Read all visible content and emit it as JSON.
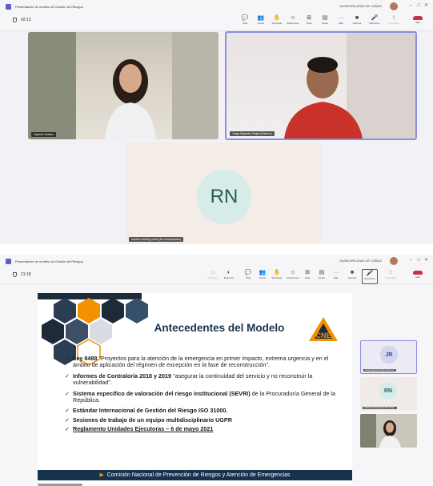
{
  "windows": [
    {
      "title": "Presentación de modelo de Gestión de Riesgos",
      "org": "MUNICIPALIDAD DE CAÑAS",
      "timer": "42:13",
      "toolbar": [
        {
          "icon": "chat-icon",
          "label": "Chat"
        },
        {
          "icon": "people-icon",
          "label": "Gente"
        },
        {
          "icon": "raise-hand-icon",
          "label": "Participar"
        },
        {
          "icon": "reaction-icon",
          "label": "Reaccionar"
        },
        {
          "icon": "view-icon",
          "label": "Vista"
        },
        {
          "icon": "notes-icon",
          "label": "Notas"
        },
        {
          "icon": "more-icon",
          "label": "Más"
        },
        {
          "icon": "camera-icon",
          "label": "Cámara"
        },
        {
          "icon": "mic-icon",
          "label": "Micrófono"
        },
        {
          "icon": "share-icon",
          "label": "Compartir"
        },
        {
          "icon": "leave-icon",
          "label": "Salir"
        }
      ],
      "participants": [
        {
          "name": "Oyalene Solano"
        },
        {
          "name": "Jorge Alejandro Rojas (Externo)"
        },
        {
          "name": "madrid meeting notes (No comprobado)",
          "initials": "RN"
        }
      ]
    },
    {
      "title": "Presentación de modelo de Gestión de Riesgos",
      "org": "MUNICIPALIDAD DE CAÑAS",
      "timer": "21:18",
      "toolbar": [
        {
          "icon": "whiteboard-icon",
          "label": "Controles"
        },
        {
          "icon": "reaction-icon-2",
          "label": "Reacción"
        },
        {
          "icon": "chat-icon",
          "label": "Chat"
        },
        {
          "icon": "people-icon",
          "label": "Gente"
        },
        {
          "icon": "raise-hand-icon",
          "label": "Participar"
        },
        {
          "icon": "reaction-icon",
          "label": "Reaccionar"
        },
        {
          "icon": "view-icon",
          "label": "Vista"
        },
        {
          "icon": "notes-icon",
          "label": "Notas"
        },
        {
          "icon": "more-icon",
          "label": "Más"
        },
        {
          "icon": "camera-icon",
          "label": "Cámara"
        },
        {
          "icon": "mic-icon",
          "label": "Micrófono"
        },
        {
          "icon": "share-icon",
          "label": "Compartir"
        },
        {
          "icon": "leave-icon",
          "label": "Salir"
        }
      ],
      "slide": {
        "title": "Antecedentes del Modelo",
        "logo_text": "CNE",
        "bullets": [
          {
            "bold": "Ley 8488",
            "text": " \"Proyectos para la atención de la emergencia en primer impacto, extrema urgencia y en el ámbito de aplicación del régimen de excepción en la fase de reconstrucción\"."
          },
          {
            "bold": "Informes de Contraloría 2018 y 2019",
            "text": " \"asegurar la continuidad del servicio y no reconstruir la vulnerabilidad\"."
          },
          {
            "bold": "Sistema específico de valoración del riesgo institucional (SEVRI)",
            "text": " de la Procuraduría General de la República."
          },
          {
            "bold": "Estándar Internacional de Gestión del Riesgo ISO 31000.",
            "text": ""
          },
          {
            "bold": "Sesiones de trabajo de un equipo multidisciplinario UGPR",
            "text": ""
          },
          {
            "bold": "Reglamento Unidades Ejecutoras – 6 de mayo 2021",
            "text": ""
          }
        ],
        "footer": "Comisión Nacional de Prevención de Riesgos y Atención de Emergencias"
      },
      "side_participants": [
        {
          "initials": "JR",
          "name": "Jorge Alejandro Rojas (Externo)"
        },
        {
          "initials": "RN",
          "name": "madrid meeting notes (No comp..."
        },
        {
          "name": ""
        }
      ]
    }
  ],
  "colors": {
    "accent": "#5b5fc7",
    "leave": "#c4314b",
    "slide_navy": "#17324d",
    "cne_orange": "#f39200"
  }
}
